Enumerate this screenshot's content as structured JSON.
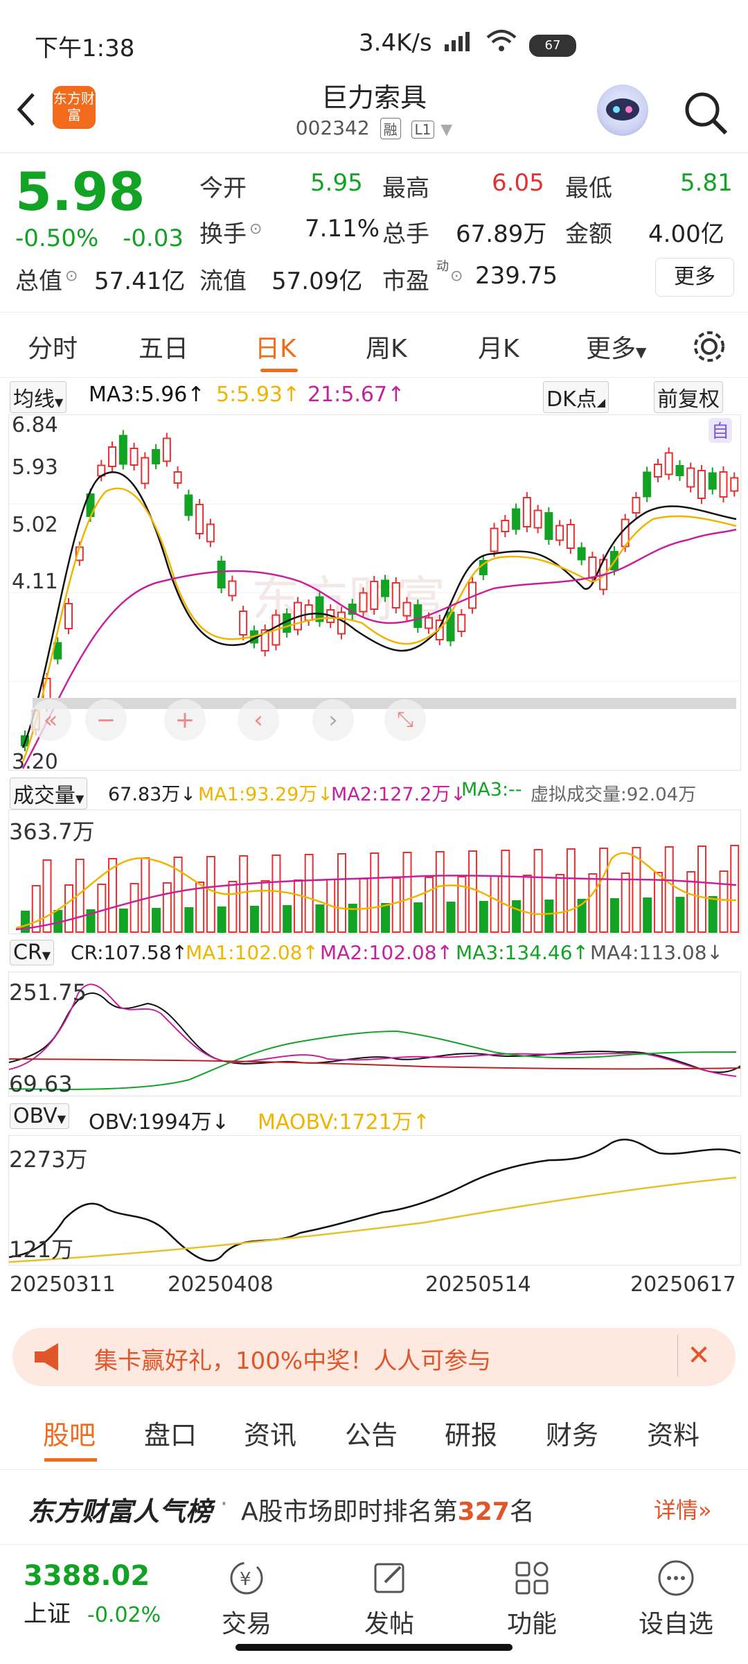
{
  "status": {
    "time": "下午1:38",
    "speed": "3.4K/s",
    "battery": "67"
  },
  "header": {
    "title": "巨力索具",
    "code": "002342",
    "tag_rong": "融",
    "tag_level": "L1",
    "logo_text": "东方财富"
  },
  "quote": {
    "price": "5.98",
    "change_pct": "-0.50%",
    "change": "-0.03",
    "open_label": "今开",
    "open": "5.95",
    "high_label": "最高",
    "high": "6.05",
    "low_label": "最低",
    "low": "5.81",
    "turnover_label": "换手",
    "turnover": "7.11%",
    "volume_label": "总手",
    "volume": "67.89万",
    "amount_label": "金额",
    "amount": "4.00亿",
    "total_cap_label": "总值",
    "total_cap": "57.41亿",
    "float_cap_label": "流值",
    "float_cap": "57.09亿",
    "pe_label": "市盈",
    "pe_sup": "动",
    "pe": "239.75",
    "more": "更多"
  },
  "tabs": [
    "分时",
    "五日",
    "日K",
    "周K",
    "月K",
    "更多"
  ],
  "kline": {
    "ma_select": "均线",
    "ma3": "MA3:5.96↑",
    "ma5": "5:5.93↑",
    "ma21": "21:5.67↑",
    "dk": "DK点",
    "fq": "前复权",
    "y_labels": [
      "6.84",
      "5.93",
      "5.02",
      "4.11",
      "3.20"
    ],
    "self_badge": "自",
    "colors": {
      "up": "#e33131",
      "down": "#12a324",
      "ma3": "#111111",
      "ma5": "#f0b400",
      "ma21": "#c81f9c"
    }
  },
  "volume": {
    "select": "成交量",
    "value": "67.83万↓",
    "ma1": "MA1:93.29万↓",
    "ma2": "MA2:127.2万↓",
    "ma3": "MA3:--",
    "virtual": "虚拟成交量:92.04万",
    "y_top": "363.7万"
  },
  "cr": {
    "select": "CR",
    "value": "CR:107.58↑",
    "ma1": "MA1:102.08↑",
    "ma2": "MA2:102.08↑",
    "ma3": "MA3:134.46↑",
    "ma4": "MA4:113.08↓",
    "y_top": "251.75",
    "y_bottom": "69.63"
  },
  "obv": {
    "select": "OBV",
    "value": "OBV:1994万↓",
    "maobv": "MAOBV:1721万↑",
    "y_top": "2273万",
    "y_bottom": "121万"
  },
  "dates": [
    "20250311",
    "20250408",
    "20250514",
    "20250617"
  ],
  "banner": {
    "text": "集卡赢好礼，100%中奖！人人可参与"
  },
  "bottom_tabs": [
    "股吧",
    "盘口",
    "资讯",
    "公告",
    "研报",
    "财务",
    "资料"
  ],
  "rank": {
    "title": "东方财富人气榜",
    "text_pre": "A股市场即时排名第",
    "rank": "327",
    "text_post": "名",
    "link": "详情"
  },
  "footer": {
    "index_value": "3388.02",
    "index_name": "上证",
    "index_change": "-0.02%",
    "items": [
      "交易",
      "发帖",
      "功能",
      "设自选"
    ]
  }
}
